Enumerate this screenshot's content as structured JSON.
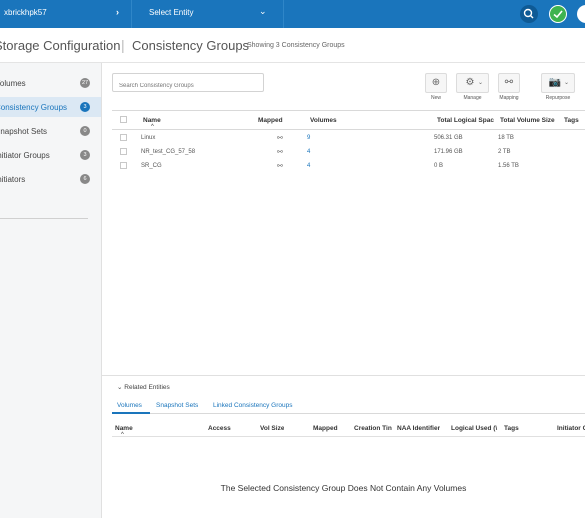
{
  "topbar": {
    "system_name": "xbrickhpk57",
    "entity_select": "Select Entity",
    "search_icon": "search-icon",
    "status_icon": "check-circle-icon",
    "brand_icon": "dell-logo-icon",
    "colors": {
      "bar": "#1a75bc",
      "ok": "#3fb34f"
    }
  },
  "title": {
    "section": "Storage Configuration",
    "page": "Consistency Groups",
    "subtitle": "Showing 3 Consistency Groups"
  },
  "sidebar": {
    "items": [
      {
        "label": "Volumes",
        "count": "27"
      },
      {
        "label": "Consistency Groups",
        "count": "3",
        "active": true
      },
      {
        "label": "Snapshot Sets",
        "count": "0"
      },
      {
        "label": "Initiator Groups",
        "count": "3"
      },
      {
        "label": "Initiators",
        "count": "6"
      }
    ]
  },
  "search": {
    "placeholder": "Search Consistency Groups"
  },
  "toolbar": {
    "new_label": "New",
    "manage_label": "Manage",
    "mapping_label": "Mapping",
    "repurpose_label": "Repurpose"
  },
  "grid": {
    "columns": [
      "Name",
      "Mapped",
      "Volumes",
      "Total Logical Spac",
      "Total Volume Size",
      "Tags"
    ],
    "rows": [
      {
        "name": "Linux",
        "volumes": "9",
        "logical": "506.31 GB",
        "size": "18 TB"
      },
      {
        "name": "NR_test_CG_57_58",
        "volumes": "4",
        "logical": "171.96 GB",
        "size": "2 TB"
      },
      {
        "name": "SR_CG",
        "volumes": "4",
        "logical": "0 B",
        "size": "1.56 TB"
      }
    ]
  },
  "related": {
    "header": "Related Entities",
    "tabs": [
      "Volumes",
      "Snapshot Sets",
      "Linked Consistency Groups"
    ],
    "columns": [
      "Name",
      "Access",
      "Vol Size",
      "Mapped",
      "Creation Tin",
      "NAA Identifier",
      "Logical Used (\\",
      "Tags",
      "Initiator G"
    ],
    "empty_message": "The Selected Consistency Group Does Not Contain Any Volumes"
  }
}
